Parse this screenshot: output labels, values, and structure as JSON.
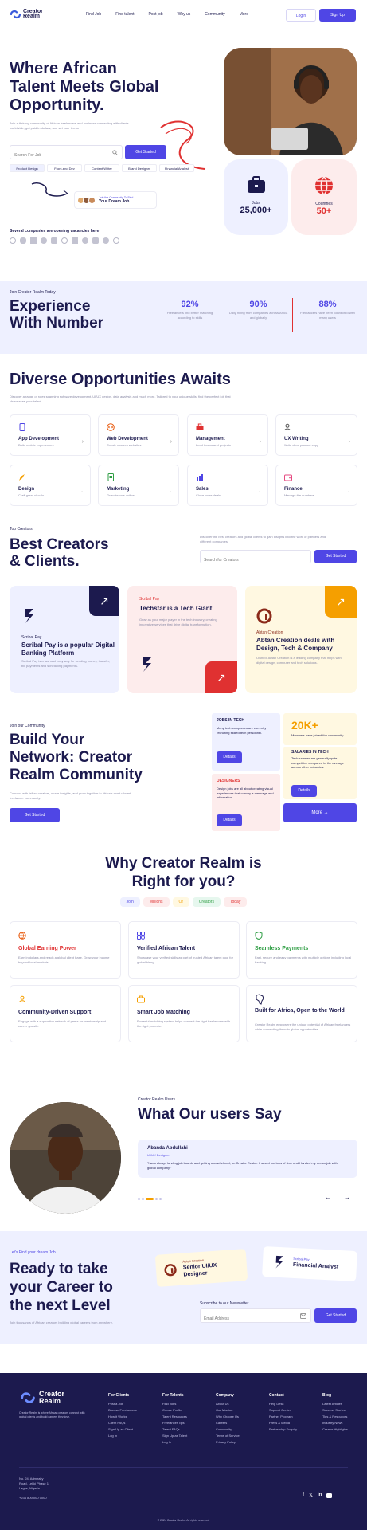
{
  "brand": {
    "name_line1": "Creator",
    "name_line2": "Realm"
  },
  "nav": {
    "links": [
      "Find Job",
      "Find talent",
      "Post job",
      "Why us",
      "Community",
      "More"
    ],
    "login": "Login",
    "signup": "Sign Up"
  },
  "hero": {
    "title_line1": "Where African",
    "title_line2": "Talent Meets Global",
    "title_line3": "Opportunity.",
    "subtitle": "Join a thriving community of African freelancers and business connecting with clients worldwide, get paid in dollars, and set your terms",
    "search_placeholder": "Search For Job",
    "cta": "Get Started",
    "tags": [
      "Product Design",
      "Front-end Dev",
      "Content Writer",
      "Brand Designer",
      "Financial Analyst"
    ],
    "join_text_line1": "Join the Community To Find",
    "join_text_line2": "Your Dream Job",
    "stat_jobs_label": "Jobs",
    "stat_jobs_value": "25,000+",
    "stat_countries_label": "Countries",
    "stat_countries_value": "50+"
  },
  "companies": {
    "label": "Several companies are opening vacancies here"
  },
  "experience": {
    "eyebrow": "Join Creator Realm Today",
    "title_line1": "Experience",
    "title_line2": "With Number",
    "stats": [
      {
        "value": "92%",
        "text": "Freelancers find better matching according to skills"
      },
      {
        "value": "90%",
        "text": "Daily hiring from companies across Africa and globally"
      },
      {
        "value": "88%",
        "text": "Freelancers have been connected with many users"
      }
    ]
  },
  "opportunities": {
    "title": "Diverse Opportunities Awaits",
    "subtitle": "Discover a range of roles spanning software development, UI/UX design, data analysis and much more. Tailored to your unique skills, find the perfect job that showcases your talent.",
    "cards": [
      {
        "title": "App Development",
        "desc": "Build mobile experiences"
      },
      {
        "title": "Web Development",
        "desc": "Create modern websites"
      },
      {
        "title": "Management",
        "desc": "Lead teams and projects"
      },
      {
        "title": "UX Writing",
        "desc": "Write clear product copy"
      },
      {
        "title": "Design",
        "desc": "Craft great visuals"
      },
      {
        "title": "Marketing",
        "desc": "Grow brands online"
      },
      {
        "title": "Sales",
        "desc": "Close more deals"
      },
      {
        "title": "Finance",
        "desc": "Manage the numbers"
      }
    ]
  },
  "creators": {
    "eyebrow": "Top Creators",
    "title_line1": "Best Creators",
    "title_line2": "& Clients.",
    "desc": "Discover the best creators and global clients to gain insights into the work of partners and different companies.",
    "search_placeholder": "Search for Creators",
    "cta": "Get Started",
    "cards": [
      {
        "tag": "Scribal Pay",
        "title": "Scribal Pay is a popular Digital Banking Platform",
        "desc": "Scribal Pay is a fast and easy way for sending money, transfer, bill payments and scheduling payments."
      },
      {
        "tag": "Scribal Pay",
        "title": "Techstar is a Tech Giant",
        "desc": "Grow as your major player in the tech industry, creating innovative services that drive digital transformation."
      },
      {
        "tag": "Abtan Creation",
        "title": "Abtan Creation deals with Design, Tech & Company",
        "desc": "Owned, Abtan Creation is a leading company that helps with digital design, computer and tech solutions."
      }
    ]
  },
  "community": {
    "eyebrow": "Join our Community",
    "title_line1": "Build Your",
    "title_line2": "Network: Creator",
    "title_line3": "Realm Community",
    "desc": "Connect with fellow creators, share insights, and grow together in Africa's most vibrant freelancer community.",
    "cta": "Get Started",
    "tile1_title": "JOBS IN TECH",
    "tile1_desc": "Many tech companies are currently recruiting skilled tech personnel.",
    "tile1_btn": "Details",
    "tile2_value": "20K+",
    "tile2_desc": "Members have joined the community",
    "tile3_title": "SALARIES IN TECH",
    "tile3_desc": "Tech salaries are generally quite competitive compared to the average across other industries.",
    "tile3_btn": "Details",
    "tile4_title": "DESIGNERS",
    "tile4_desc": "Design jobs are all about creating visual experiences that convey a message and information.",
    "tile4_btn": "Details",
    "more": "More"
  },
  "why": {
    "title_line1": "Why Creator Realm is",
    "title_line2": "Right for you?",
    "pills": [
      "Join",
      "Millions",
      "Of",
      "Creators",
      "Today"
    ],
    "features": [
      {
        "title": "Global Earning Power",
        "desc": "Earn in dollars and reach a global client base. Grow your income beyond local markets."
      },
      {
        "title": "Verified African Talent",
        "desc": "Showcase your verified skills as part of trusted African talent pool for global hiring."
      },
      {
        "title": "Seamless Payments",
        "desc": "Fast, secure and easy payments with multiple options including local banking."
      },
      {
        "title": "Community-Driven Support",
        "desc": "Engage with a supportive network of peers for mentorship and career growth."
      },
      {
        "title": "Smart Job Matching",
        "desc": "Powerful matching system helps connect the right freelancers with the right projects."
      },
      {
        "title": "Built for Africa, Open to the World",
        "desc": "Creator Realm empowers the unique potential of African freelancers while connecting them to global opportunities."
      }
    ]
  },
  "testimonial": {
    "eyebrow": "Creator Realm Users",
    "title": "What Our users Say",
    "name": "Abanda Abdullahi",
    "role": "UI/UX Designer",
    "quote": "\"I was always landing job boards and getting overwhelmed, on Creator Realm. It saved me tons of time and I landed my dream job with global company.\""
  },
  "cta_section": {
    "eyebrow": "Let's Find your dream Job",
    "title_line1": "Ready to take",
    "title_line2": "your Career to",
    "title_line3": "the next Level",
    "desc": "Join thousands of African creators building global careers from anywhere.",
    "card1_tag": "Abtan Creation",
    "card1_title_line1": "Senior UI/UX",
    "card1_title_line2": "Designer",
    "card2_tag": "Scribal Pay",
    "card2_title": "Financial Analyst",
    "subscribe_label": "Subscribe to our Newsletter",
    "email_placeholder": "Email Address",
    "cta": "Get Started"
  },
  "footer": {
    "desc": "Creator Realm is where African creators connect with global clients and build careers they love.",
    "columns": [
      {
        "head": "For Clients",
        "links": [
          "Post a Job",
          "Browse Freelancers",
          "How it Works",
          "Client FAQs",
          "Sign Up as Client",
          "Log In"
        ]
      },
      {
        "head": "For Talents",
        "links": [
          "Find Jobs",
          "Create Profile",
          "Talent Resources",
          "Freelancer Tips",
          "Talent FAQs",
          "Sign Up as Talent",
          "Log In"
        ]
      },
      {
        "head": "Company",
        "links": [
          "About Us",
          "Our Mission",
          "Why Choose Us",
          "Careers",
          "Community",
          "Terms of Service",
          "Privacy Policy"
        ]
      },
      {
        "head": "Contact",
        "links": [
          "Help Desk",
          "Support Center",
          "Partner Program",
          "Press & Media",
          "Partnership Enquiry"
        ]
      },
      {
        "head": "Blog",
        "links": [
          "Latest Articles",
          "Success Stories",
          "Tips & Resources",
          "Industry News",
          "Creator Highlights"
        ]
      }
    ],
    "address_line1": "No. 24, Admiralty",
    "address_line2": "Road, Lekki Phase 1",
    "address_line3": "Lagos, Nigeria",
    "phone": "+234 800 000 0000",
    "copyright": "© 2024 Creator Realm. All rights reserved."
  }
}
